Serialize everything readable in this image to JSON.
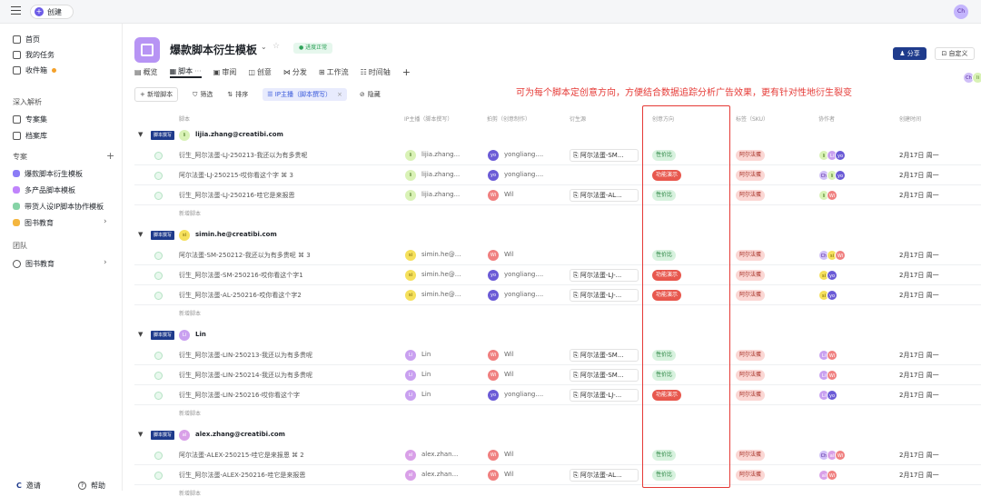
{
  "topbar": {
    "create_label": "创建",
    "user_avatar": "Ch"
  },
  "sidebar": {
    "nav": [
      {
        "label": "首页"
      },
      {
        "label": "我的任务"
      },
      {
        "label": "收件箱"
      }
    ],
    "section_insight": "深入解析",
    "insight_items": [
      {
        "label": "专案集"
      },
      {
        "label": "档案库"
      }
    ],
    "section_projects": "专案",
    "projects": [
      {
        "label": "爆款脚本衍生模板",
        "color": "#8b7cf6"
      },
      {
        "label": "多产品脚本模板",
        "color": "#c084fc"
      },
      {
        "label": "带货人设IP脚本协作模板",
        "color": "#86d3a6"
      },
      {
        "label": "图书教育",
        "color": "#f4b63f"
      }
    ],
    "section_team": "团队",
    "team_item": "图书教育",
    "invite_label": "邀请",
    "help_label": "帮助"
  },
  "project": {
    "title": "爆款脚本衍生模板",
    "status": "● 进度正常",
    "share_label": "分享",
    "custom_label": "自定义",
    "members": [
      "Ch",
      "li",
      "yo",
      "+6"
    ]
  },
  "tabs": [
    "概览",
    "脚本",
    "审阅",
    "创意",
    "分发",
    "工作流",
    "时间轴"
  ],
  "toolbar": {
    "new_label": "+ 新增脚本",
    "filter_label": "筛选",
    "sort_label": "排序",
    "chip_label": "IP主播（脚本撰写）",
    "hide_label": "隐藏"
  },
  "annotation": "可为每个脚本定创意方向，方便结合数据追踪分析广告效果，更有针对性地衍生裂变",
  "columns": [
    "脚本",
    "IP主播（脚本撰写）",
    "拍剪（创意制作）",
    "衍生源",
    "创意方向",
    "标签（SKU）",
    "协作者",
    "创建时间"
  ],
  "groups": [
    {
      "tag": "脚本撰写",
      "avatar": "li",
      "name": "lijia.zhang@creatibi.com",
      "rows": [
        {
          "title": "衍生_阿尔法蛋-LJ-250213-我还以为有多贵呢",
          "ip_av": "li",
          "ip": "lijia.zhang...",
          "cut_av": "yo",
          "cut": "yongliang....",
          "src": "阿尔法蛋-SM...",
          "dir": "性价比",
          "dir_type": "green",
          "sku": "阿尔法蛋",
          "collab": [
            "li",
            "Li",
            "yo"
          ],
          "date": "2月17日 周一"
        },
        {
          "title": "阿尔法蛋-LJ-250215-哎你看这个字  ⌘ 3",
          "ip_av": "li",
          "ip": "lijia.zhang...",
          "cut_av": "yo",
          "cut": "yongliang....",
          "src": "",
          "dir": "功能演示",
          "dir_type": "red",
          "sku": "阿尔法蛋",
          "collab": [
            "Ch",
            "li",
            "yo"
          ],
          "date": "2月17日 周一"
        },
        {
          "title": "衍生_阿尔法蛋-LJ-250216-哇它是来报恩",
          "ip_av": "li",
          "ip": "lijia.zhang...",
          "cut_av": "Wi",
          "cut": "Wil",
          "src": "阿尔法蛋-AL...",
          "dir": "性价比",
          "dir_type": "green",
          "sku": "阿尔法蛋",
          "collab": [
            "li",
            "Wi"
          ],
          "date": "2月17日 周一"
        }
      ]
    },
    {
      "tag": "脚本撰写",
      "avatar": "si",
      "name": "simin.he@creatibi.com",
      "rows": [
        {
          "title": "阿尔法蛋-SM-250212-我还以为有多贵呢  ⌘ 3",
          "ip_av": "si",
          "ip": "simin.he@...",
          "cut_av": "Wi",
          "cut": "Wil",
          "src": "",
          "dir": "性价比",
          "dir_type": "green",
          "sku": "阿尔法蛋",
          "collab": [
            "Ch",
            "si",
            "Wi"
          ],
          "date": "2月17日 周一"
        },
        {
          "title": "衍生_阿尔法蛋-SM-250216-哎你看这个字1",
          "ip_av": "si",
          "ip": "simin.he@...",
          "cut_av": "yo",
          "cut": "yongliang....",
          "src": "阿尔法蛋-LJ-...",
          "dir": "功能演示",
          "dir_type": "red",
          "sku": "阿尔法蛋",
          "collab": [
            "si",
            "yo"
          ],
          "date": "2月17日 周一"
        },
        {
          "title": "衍生_阿尔法蛋-AL-250216-哎你看这个字2",
          "ip_av": "si",
          "ip": "simin.he@...",
          "cut_av": "yo",
          "cut": "yongliang....",
          "src": "阿尔法蛋-LJ-...",
          "dir": "功能演示",
          "dir_type": "red",
          "sku": "阿尔法蛋",
          "collab": [
            "si",
            "yo"
          ],
          "date": "2月17日 周一"
        }
      ]
    },
    {
      "tag": "脚本撰写",
      "avatar": "Li",
      "name": "Lin",
      "rows": [
        {
          "title": "衍生_阿尔法蛋-LIN-250213-我还以为有多贵呢",
          "ip_av": "Li",
          "ip": "Lin",
          "cut_av": "Wi",
          "cut": "Wil",
          "src": "阿尔法蛋-SM...",
          "dir": "性价比",
          "dir_type": "green",
          "sku": "阿尔法蛋",
          "collab": [
            "Li",
            "Wi"
          ],
          "date": "2月17日 周一"
        },
        {
          "title": "衍生_阿尔法蛋-LIN-250214-我还以为有多贵呢",
          "ip_av": "Li",
          "ip": "Lin",
          "cut_av": "Wi",
          "cut": "Wil",
          "src": "阿尔法蛋-SM...",
          "dir": "性价比",
          "dir_type": "green",
          "sku": "阿尔法蛋",
          "collab": [
            "Li",
            "Wi"
          ],
          "date": "2月17日 周一"
        },
        {
          "title": "衍生_阿尔法蛋-LIN-250216-哎你看这个字",
          "ip_av": "Li",
          "ip": "Lin",
          "cut_av": "yo",
          "cut": "yongliang....",
          "src": "阿尔法蛋-LJ-...",
          "dir": "功能演示",
          "dir_type": "red",
          "sku": "阿尔法蛋",
          "collab": [
            "Li",
            "yo"
          ],
          "date": "2月17日 周一"
        }
      ]
    },
    {
      "tag": "脚本撰写",
      "avatar": "al",
      "name": "alex.zhang@creatibi.com",
      "rows": [
        {
          "title": "阿尔法蛋-ALEX-250215-哇它是来报恩  ⌘ 2",
          "ip_av": "al",
          "ip": "alex.zhan...",
          "cut_av": "Wi",
          "cut": "Wil",
          "src": "",
          "dir": "性价比",
          "dir_type": "green",
          "sku": "阿尔法蛋",
          "collab": [
            "Ch",
            "al",
            "Wi"
          ],
          "date": "2月17日 周一"
        },
        {
          "title": "衍生_阿尔法蛋-ALEX-250216-哇它是来报恩",
          "ip_av": "al",
          "ip": "alex.zhan...",
          "cut_av": "Wi",
          "cut": "Wil",
          "src": "阿尔法蛋-AL...",
          "dir": "性价比",
          "dir_type": "green",
          "sku": "阿尔法蛋",
          "collab": [
            "al",
            "Wi"
          ],
          "date": "2月17日 周一"
        }
      ]
    }
  ],
  "new_row_label": "新增脚本"
}
